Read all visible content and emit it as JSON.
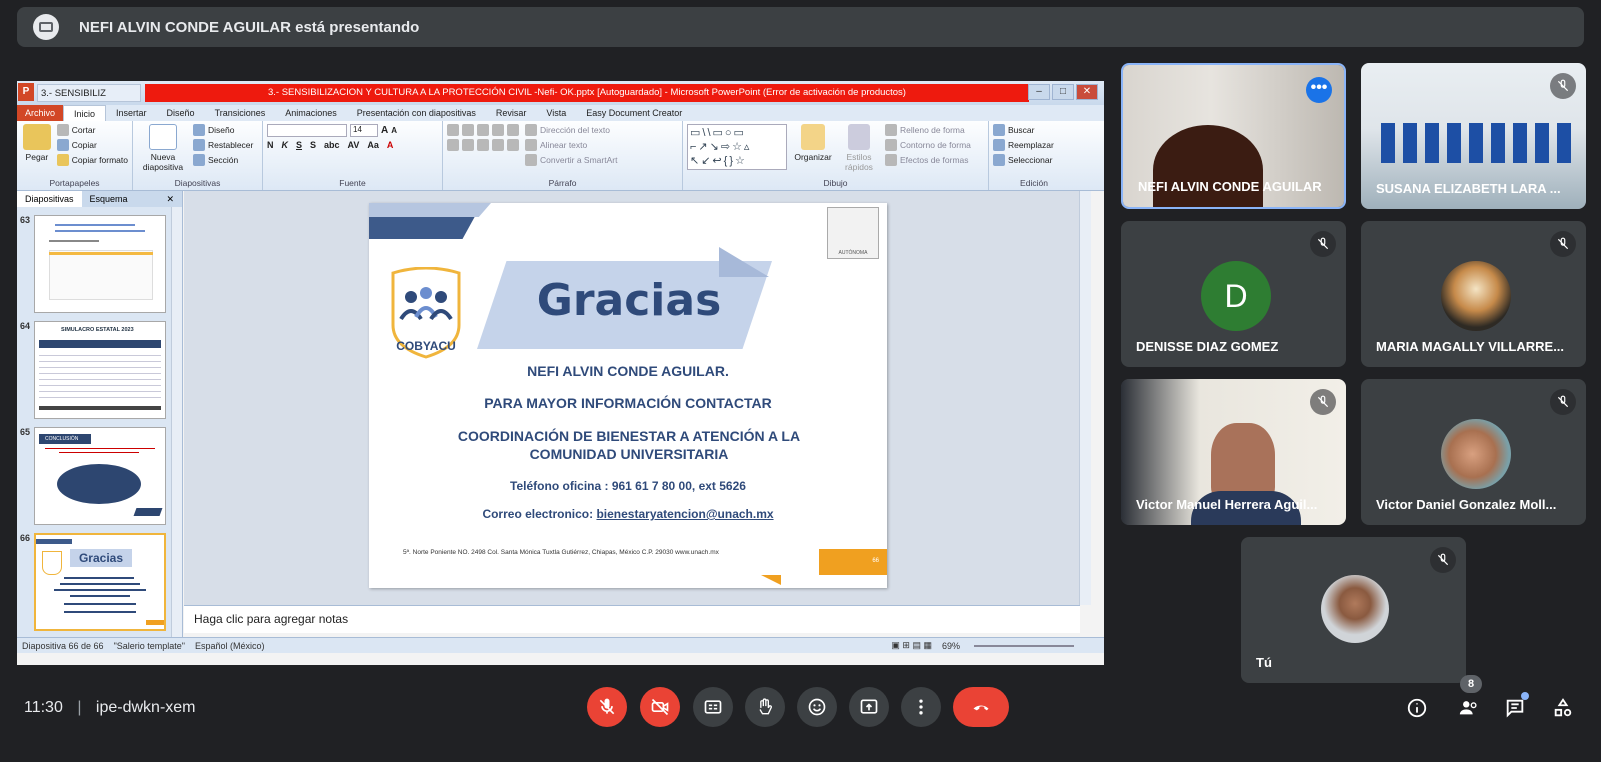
{
  "meet": {
    "presenter_banner": "NEFI ALVIN CONDE AGUILAR está presentando",
    "time": "11:30",
    "meeting_code": "ipe-dwkn-xem",
    "participant_count": "8"
  },
  "ppt": {
    "doc_tab": "3.- SENSIBILIZ",
    "window_title": "3.- SENSIBILIZACION Y CULTURA A LA PROTECCIÓN CIVIL -Nefi- OK.pptx [Autoguardado] - Microsoft PowerPoint (Error de activación de productos)",
    "ribbon_tabs": [
      "Archivo",
      "Inicio",
      "Insertar",
      "Diseño",
      "Transiciones",
      "Animaciones",
      "Presentación con diapositivas",
      "Revisar",
      "Vista",
      "Easy Document Creator"
    ],
    "groups": {
      "portapapeles": "Portapapeles",
      "diapositivas": "Diapositivas",
      "fuente": "Fuente",
      "parrafo": "Párrafo",
      "dibujo": "Dibujo",
      "edicion": "Edición"
    },
    "clipboard": {
      "paste": "Pegar",
      "cut": "Cortar",
      "copy": "Copiar",
      "format": "Copiar formato"
    },
    "slides_grp": {
      "new": "Nueva diapositiva",
      "layout": "Diseño",
      "reset": "Restablecer",
      "section": "Sección"
    },
    "para": {
      "direction": "Dirección del texto",
      "align": "Alinear texto",
      "smartart": "Convertir a SmartArt"
    },
    "draw": {
      "arrange": "Organizar",
      "styles": "Estilos rápidos",
      "fill": "Relleno de forma",
      "outline": "Contorno de forma",
      "effects": "Efectos de formas"
    },
    "edit": {
      "find": "Buscar",
      "replace": "Reemplazar",
      "select": "Seleccionar"
    },
    "font_size": "14",
    "pane_tabs": [
      "Diapositivas",
      "Esquema"
    ],
    "thumb_numbers": [
      "63",
      "64",
      "65",
      "66"
    ],
    "thumb64_title": "SIMULACRO ESTATAL 2023",
    "thumb65_title": "CONCLUSIÓN",
    "thumb66_title": "Gracias",
    "notes_placeholder": "Haga clic para agregar notas",
    "status": {
      "slide": "Diapositiva 66 de 66",
      "theme": "\"Salerio template\"",
      "lang": "Español (México)",
      "zoom": "69%"
    }
  },
  "slide": {
    "title": "Gracias",
    "logo_text": "COBYACU",
    "name": "NEFI ALVIN CONDE AGUILAR.",
    "line1": "PARA MAYOR INFORMACIÓN CONTACTAR",
    "line2": "COORDINACIÓN DE BIENESTAR A ATENCIÓN A LA COMUNIDAD  UNIVERSITARIA",
    "phone": "Teléfono oficina : 961 61 7 80 00, ext 5626",
    "email_label": "Correo electronico: ",
    "email": "bienestaryatencion@unach.mx",
    "address": "5ª. Norte Poniente NO. 2498  Col. Santa Mónica Tuxtla Gutiérrez, Chiapas, México C.P. 29030  www.unach.mx",
    "page_num": "66",
    "seal_text": "AUTÓNOMA"
  },
  "participants": [
    {
      "name": "NEFI ALVIN CONDE AGUILAR"
    },
    {
      "name": "SUSANA ELIZABETH LARA ..."
    },
    {
      "name": "DENISSE DIAZ GOMEZ",
      "initial": "D"
    },
    {
      "name": "MARIA MAGALLY VILLARRE..."
    },
    {
      "name": "Victor Manuel Herrera Aguil..."
    },
    {
      "name": "Victor Daniel Gonzalez Moll..."
    },
    {
      "name": "Tú"
    }
  ],
  "colors": {
    "meet_bg": "#202124",
    "tile_bg": "#3c4043",
    "end_call": "#ea4335",
    "accent_blue": "#1a73e8",
    "avatar_green": "#2e7d32",
    "slide_navy": "#2f4a7a"
  }
}
